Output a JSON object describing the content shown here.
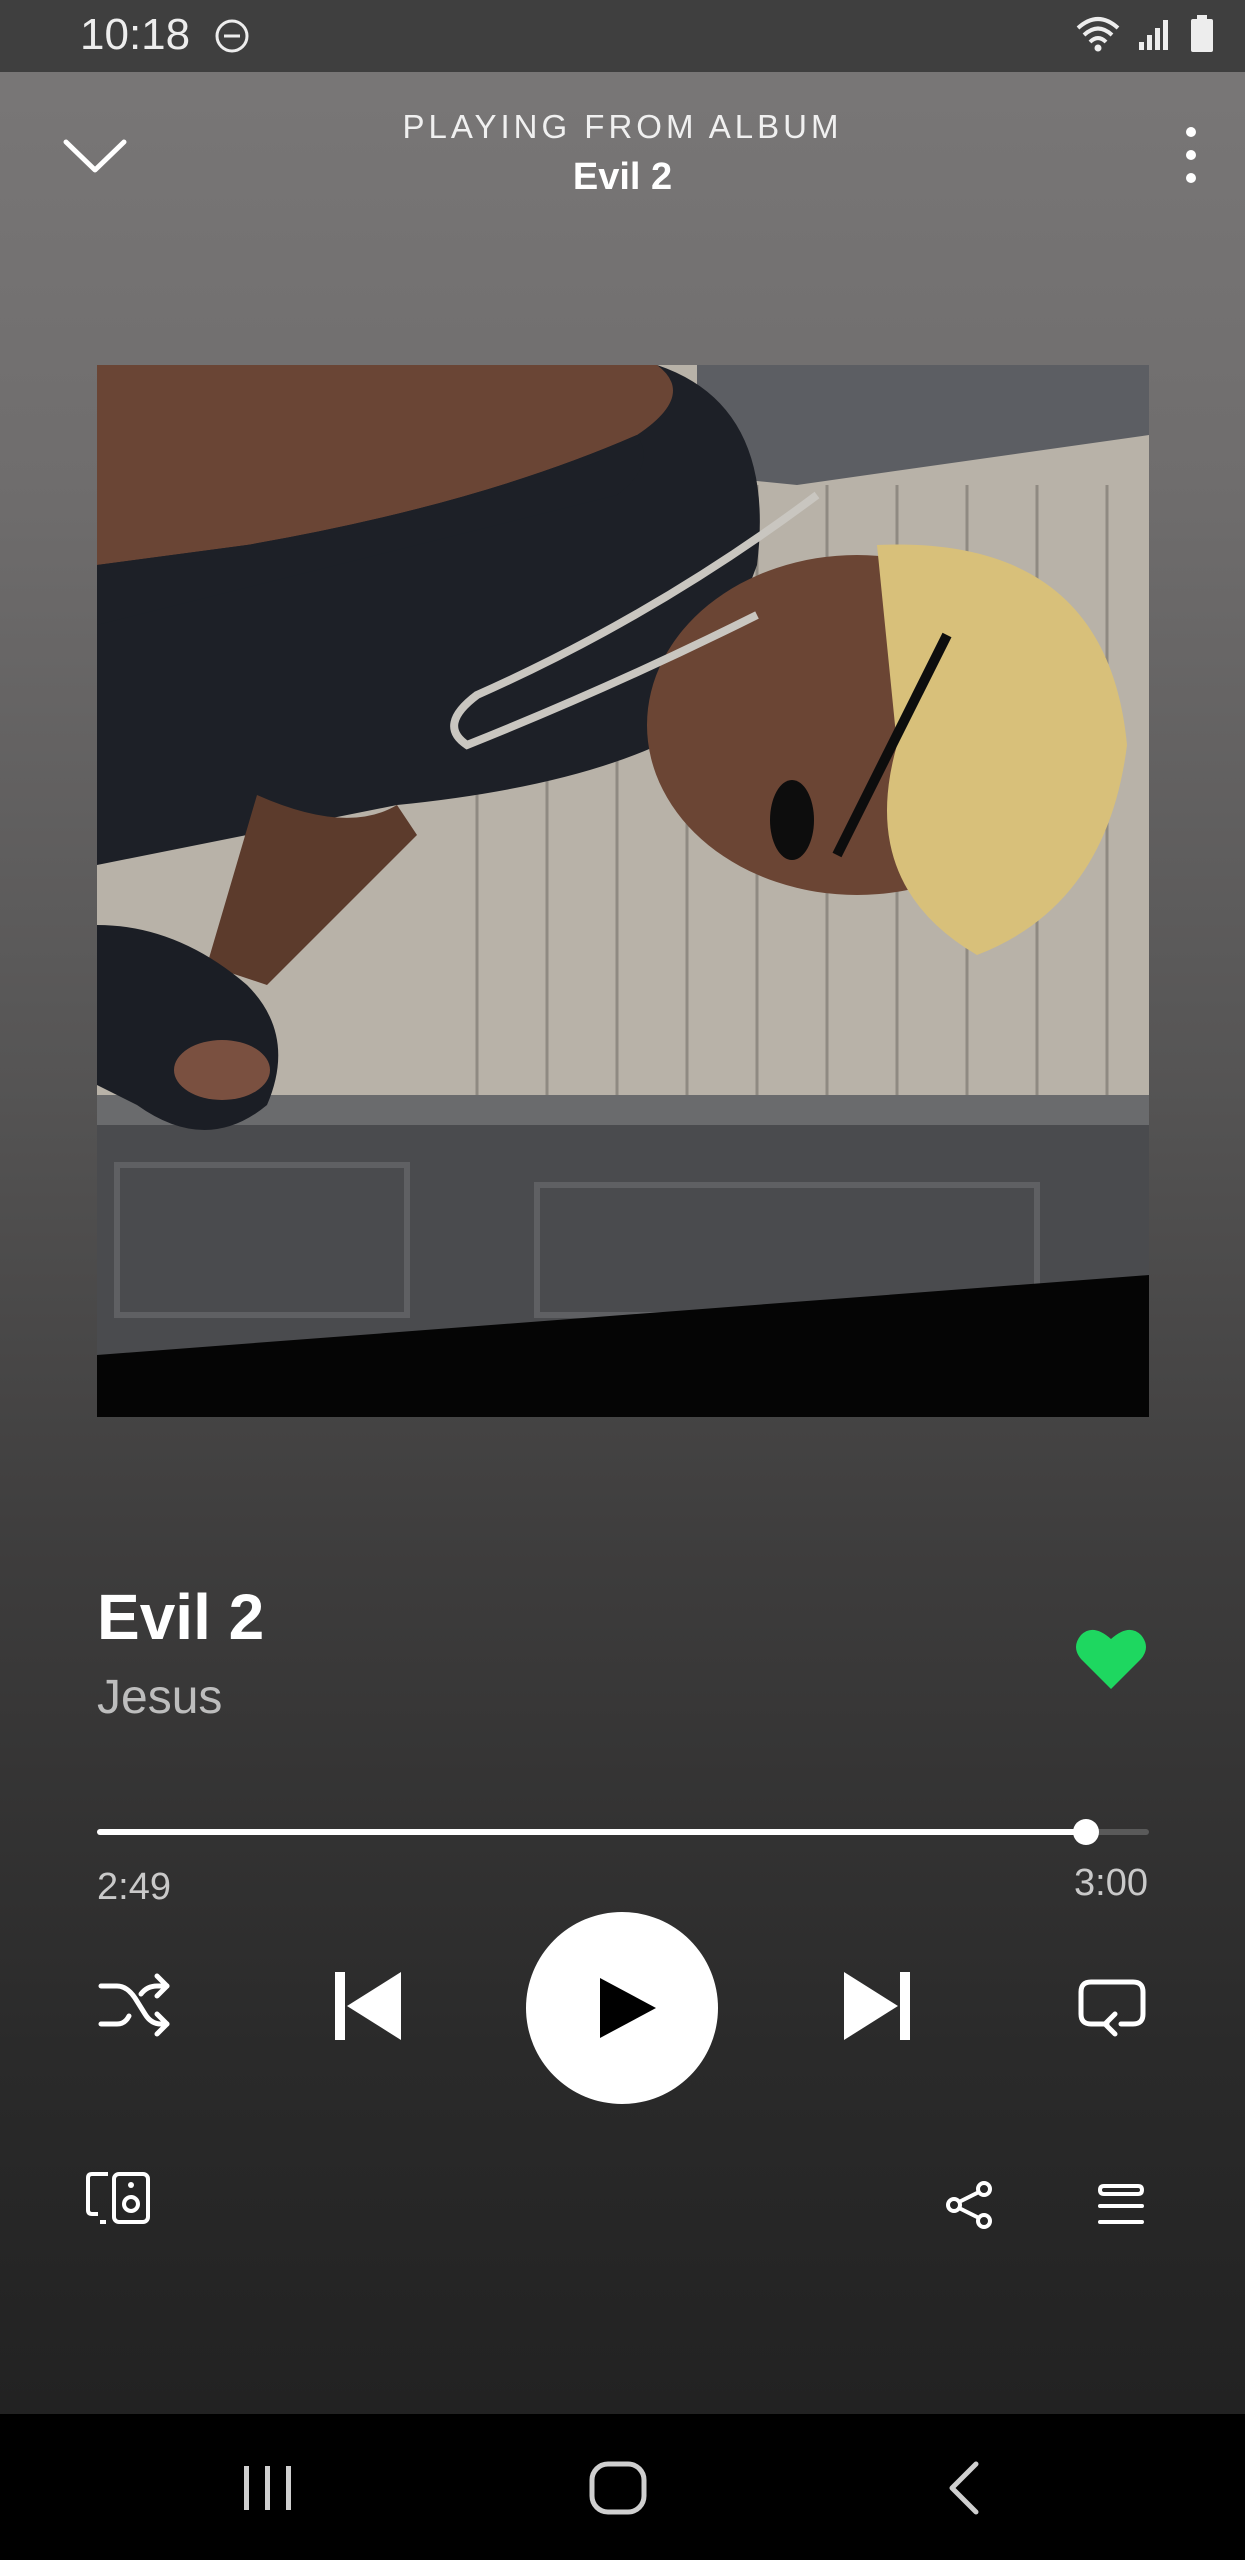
{
  "status_bar": {
    "time": "10:18",
    "icons": [
      "do-not-disturb-icon",
      "wifi-icon",
      "signal-icon",
      "battery-icon"
    ]
  },
  "header": {
    "context_label": "PLAYING FROM ALBUM",
    "context_name": "Evil 2"
  },
  "track": {
    "title": "Evil 2",
    "artist": "Jesus",
    "liked": true
  },
  "playback": {
    "elapsed": "2:49",
    "total": "3:00",
    "progress_fraction": 0.94,
    "state": "paused"
  },
  "controls": {
    "icons": [
      "shuffle-icon",
      "previous-icon",
      "play-icon",
      "next-icon",
      "repeat-icon"
    ]
  },
  "bottom_bar": {
    "icons": [
      "devices-icon",
      "share-icon",
      "queue-icon"
    ]
  },
  "nav_bar": {
    "icons": [
      "recents-icon",
      "home-icon",
      "back-icon"
    ]
  },
  "colors": {
    "accent_green": "#1ed760",
    "background_top": "#7a7878",
    "background_bottom": "#222222"
  }
}
